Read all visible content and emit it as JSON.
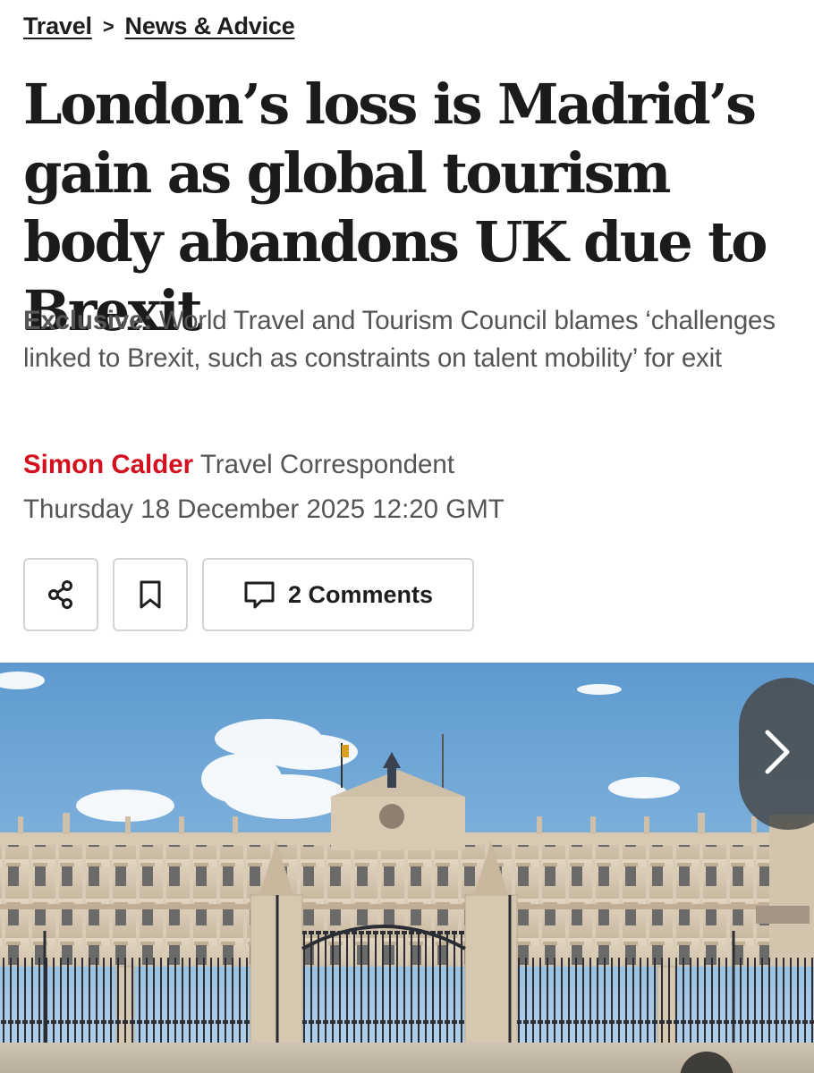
{
  "breadcrumb": {
    "items": [
      {
        "label": "Travel"
      },
      {
        "label": "News & Advice"
      }
    ],
    "separator": ">"
  },
  "article": {
    "headline": "London’s loss is Madrid’s gain as global tourism body abandons UK due to Brexit",
    "standfirst_label": "Exclusive:",
    "standfirst_text": "World Travel and Tourism Council blames ‘challenges linked to Brexit, such as constraints on talent mobility’ for exit",
    "author": "Simon Calder",
    "author_role": "Travel Correspondent",
    "date": "Thursday 18 December 2025 12:20 GMT"
  },
  "actions": {
    "share_icon": "share-icon",
    "bookmark_icon": "bookmark-icon",
    "comments_icon": "comment-icon",
    "comments_label": "2 Comments"
  },
  "gallery": {
    "next_icon": "chevron-right-icon"
  },
  "colors": {
    "author_red": "#d3101e",
    "text_dark": "#1b1b1b",
    "text_grey": "#555555",
    "button_border": "#d4d4d4"
  }
}
